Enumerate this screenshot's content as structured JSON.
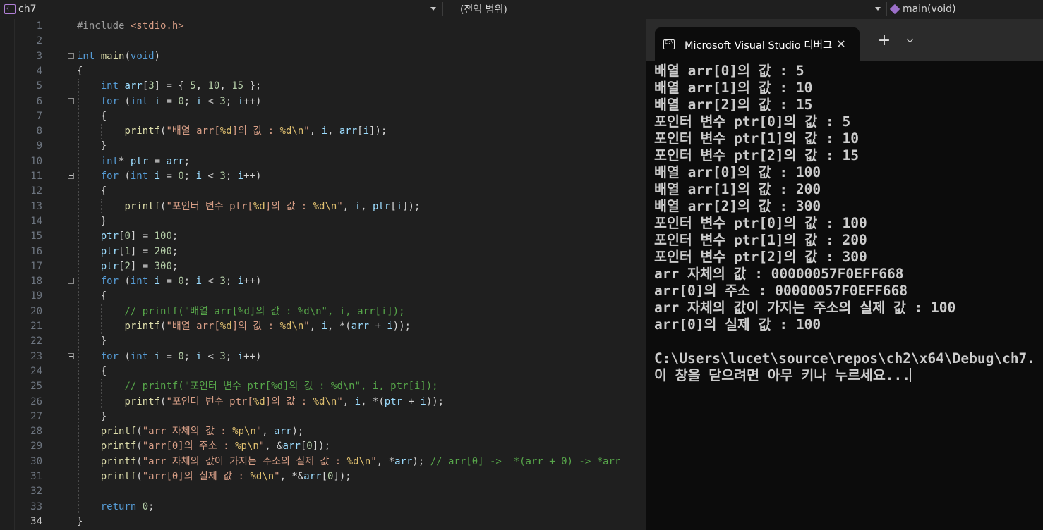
{
  "navbar": {
    "project": "ch7",
    "scope": "(전역 범위)",
    "function": "main(void)"
  },
  "editor": {
    "current_line": 34,
    "lines": [
      {
        "n": "1",
        "tokens": [
          {
            "t": "pp",
            "v": "#include "
          },
          {
            "t": "inc",
            "v": "<stdio.h>"
          }
        ]
      },
      {
        "n": "2",
        "tokens": []
      },
      {
        "n": "3",
        "tokens": [
          {
            "t": "kw",
            "v": "int"
          },
          {
            "t": "pl",
            "v": " "
          },
          {
            "t": "fn",
            "v": "main"
          },
          {
            "t": "pl",
            "v": "("
          },
          {
            "t": "kw",
            "v": "void"
          },
          {
            "t": "pl",
            "v": ")"
          }
        ]
      },
      {
        "n": "4",
        "tokens": [
          {
            "t": "pl",
            "v": "{"
          }
        ]
      },
      {
        "n": "5",
        "tokens": [
          {
            "t": "pl",
            "v": "    "
          },
          {
            "t": "kw",
            "v": "int"
          },
          {
            "t": "pl",
            "v": " "
          },
          {
            "t": "var",
            "v": "arr"
          },
          {
            "t": "pl",
            "v": "["
          },
          {
            "t": "num",
            "v": "3"
          },
          {
            "t": "pl",
            "v": "] = { "
          },
          {
            "t": "num",
            "v": "5"
          },
          {
            "t": "pl",
            "v": ", "
          },
          {
            "t": "num",
            "v": "10"
          },
          {
            "t": "pl",
            "v": ", "
          },
          {
            "t": "num",
            "v": "15"
          },
          {
            "t": "pl",
            "v": " };"
          }
        ]
      },
      {
        "n": "6",
        "tokens": [
          {
            "t": "pl",
            "v": "    "
          },
          {
            "t": "kw",
            "v": "for"
          },
          {
            "t": "pl",
            "v": " ("
          },
          {
            "t": "kw",
            "v": "int"
          },
          {
            "t": "pl",
            "v": " "
          },
          {
            "t": "var",
            "v": "i"
          },
          {
            "t": "pl",
            "v": " = "
          },
          {
            "t": "num",
            "v": "0"
          },
          {
            "t": "pl",
            "v": "; "
          },
          {
            "t": "var",
            "v": "i"
          },
          {
            "t": "pl",
            "v": " < "
          },
          {
            "t": "num",
            "v": "3"
          },
          {
            "t": "pl",
            "v": "; "
          },
          {
            "t": "var",
            "v": "i"
          },
          {
            "t": "pl",
            "v": "++)"
          }
        ]
      },
      {
        "n": "7",
        "tokens": [
          {
            "t": "pl",
            "v": "    {"
          }
        ]
      },
      {
        "n": "8",
        "tokens": [
          {
            "t": "pl",
            "v": "        "
          },
          {
            "t": "fn",
            "v": "printf"
          },
          {
            "t": "pl",
            "v": "("
          },
          {
            "t": "str",
            "v": "\"배열 arr["
          },
          {
            "t": "esc",
            "v": "%d"
          },
          {
            "t": "str",
            "v": "]의 값 : "
          },
          {
            "t": "esc",
            "v": "%d\\n"
          },
          {
            "t": "str",
            "v": "\""
          },
          {
            "t": "pl",
            "v": ", "
          },
          {
            "t": "var",
            "v": "i"
          },
          {
            "t": "pl",
            "v": ", "
          },
          {
            "t": "var",
            "v": "arr"
          },
          {
            "t": "pl",
            "v": "["
          },
          {
            "t": "var",
            "v": "i"
          },
          {
            "t": "pl",
            "v": "]);"
          }
        ]
      },
      {
        "n": "9",
        "tokens": [
          {
            "t": "pl",
            "v": "    }"
          }
        ]
      },
      {
        "n": "10",
        "tokens": [
          {
            "t": "pl",
            "v": "    "
          },
          {
            "t": "kw",
            "v": "int"
          },
          {
            "t": "pl",
            "v": "* "
          },
          {
            "t": "var",
            "v": "ptr"
          },
          {
            "t": "pl",
            "v": " = "
          },
          {
            "t": "var",
            "v": "arr"
          },
          {
            "t": "pl",
            "v": ";"
          }
        ]
      },
      {
        "n": "11",
        "tokens": [
          {
            "t": "pl",
            "v": "    "
          },
          {
            "t": "kw",
            "v": "for"
          },
          {
            "t": "pl",
            "v": " ("
          },
          {
            "t": "kw",
            "v": "int"
          },
          {
            "t": "pl",
            "v": " "
          },
          {
            "t": "var",
            "v": "i"
          },
          {
            "t": "pl",
            "v": " = "
          },
          {
            "t": "num",
            "v": "0"
          },
          {
            "t": "pl",
            "v": "; "
          },
          {
            "t": "var",
            "v": "i"
          },
          {
            "t": "pl",
            "v": " < "
          },
          {
            "t": "num",
            "v": "3"
          },
          {
            "t": "pl",
            "v": "; "
          },
          {
            "t": "var",
            "v": "i"
          },
          {
            "t": "pl",
            "v": "++)"
          }
        ]
      },
      {
        "n": "12",
        "tokens": [
          {
            "t": "pl",
            "v": "    {"
          }
        ]
      },
      {
        "n": "13",
        "tokens": [
          {
            "t": "pl",
            "v": "        "
          },
          {
            "t": "fn",
            "v": "printf"
          },
          {
            "t": "pl",
            "v": "("
          },
          {
            "t": "str",
            "v": "\"포인터 변수 ptr["
          },
          {
            "t": "esc",
            "v": "%d"
          },
          {
            "t": "str",
            "v": "]의 값 : "
          },
          {
            "t": "esc",
            "v": "%d\\n"
          },
          {
            "t": "str",
            "v": "\""
          },
          {
            "t": "pl",
            "v": ", "
          },
          {
            "t": "var",
            "v": "i"
          },
          {
            "t": "pl",
            "v": ", "
          },
          {
            "t": "var",
            "v": "ptr"
          },
          {
            "t": "pl",
            "v": "["
          },
          {
            "t": "var",
            "v": "i"
          },
          {
            "t": "pl",
            "v": "]);"
          }
        ]
      },
      {
        "n": "14",
        "tokens": [
          {
            "t": "pl",
            "v": "    }"
          }
        ]
      },
      {
        "n": "15",
        "tokens": [
          {
            "t": "pl",
            "v": "    "
          },
          {
            "t": "var",
            "v": "ptr"
          },
          {
            "t": "pl",
            "v": "["
          },
          {
            "t": "num",
            "v": "0"
          },
          {
            "t": "pl",
            "v": "] = "
          },
          {
            "t": "num",
            "v": "100"
          },
          {
            "t": "pl",
            "v": ";"
          }
        ]
      },
      {
        "n": "16",
        "tokens": [
          {
            "t": "pl",
            "v": "    "
          },
          {
            "t": "var",
            "v": "ptr"
          },
          {
            "t": "pl",
            "v": "["
          },
          {
            "t": "num",
            "v": "1"
          },
          {
            "t": "pl",
            "v": "] = "
          },
          {
            "t": "num",
            "v": "200"
          },
          {
            "t": "pl",
            "v": ";"
          }
        ]
      },
      {
        "n": "17",
        "tokens": [
          {
            "t": "pl",
            "v": "    "
          },
          {
            "t": "var",
            "v": "ptr"
          },
          {
            "t": "pl",
            "v": "["
          },
          {
            "t": "num",
            "v": "2"
          },
          {
            "t": "pl",
            "v": "] = "
          },
          {
            "t": "num",
            "v": "300"
          },
          {
            "t": "pl",
            "v": ";"
          }
        ]
      },
      {
        "n": "18",
        "tokens": [
          {
            "t": "pl",
            "v": "    "
          },
          {
            "t": "kw",
            "v": "for"
          },
          {
            "t": "pl",
            "v": " ("
          },
          {
            "t": "kw",
            "v": "int"
          },
          {
            "t": "pl",
            "v": " "
          },
          {
            "t": "var",
            "v": "i"
          },
          {
            "t": "pl",
            "v": " = "
          },
          {
            "t": "num",
            "v": "0"
          },
          {
            "t": "pl",
            "v": "; "
          },
          {
            "t": "var",
            "v": "i"
          },
          {
            "t": "pl",
            "v": " < "
          },
          {
            "t": "num",
            "v": "3"
          },
          {
            "t": "pl",
            "v": "; "
          },
          {
            "t": "var",
            "v": "i"
          },
          {
            "t": "pl",
            "v": "++)"
          }
        ]
      },
      {
        "n": "19",
        "tokens": [
          {
            "t": "pl",
            "v": "    {"
          }
        ]
      },
      {
        "n": "20",
        "tokens": [
          {
            "t": "pl",
            "v": "        "
          },
          {
            "t": "cm",
            "v": "// printf(\"배열 arr[%d]의 값 : %d\\n\", i, arr[i]);"
          }
        ]
      },
      {
        "n": "21",
        "tokens": [
          {
            "t": "pl",
            "v": "        "
          },
          {
            "t": "fn",
            "v": "printf"
          },
          {
            "t": "pl",
            "v": "("
          },
          {
            "t": "str",
            "v": "\"배열 arr["
          },
          {
            "t": "esc",
            "v": "%d"
          },
          {
            "t": "str",
            "v": "]의 값 : "
          },
          {
            "t": "esc",
            "v": "%d\\n"
          },
          {
            "t": "str",
            "v": "\""
          },
          {
            "t": "pl",
            "v": ", "
          },
          {
            "t": "var",
            "v": "i"
          },
          {
            "t": "pl",
            "v": ", *("
          },
          {
            "t": "var",
            "v": "arr"
          },
          {
            "t": "pl",
            "v": " + "
          },
          {
            "t": "var",
            "v": "i"
          },
          {
            "t": "pl",
            "v": "));"
          }
        ]
      },
      {
        "n": "22",
        "tokens": [
          {
            "t": "pl",
            "v": "    }"
          }
        ]
      },
      {
        "n": "23",
        "tokens": [
          {
            "t": "pl",
            "v": "    "
          },
          {
            "t": "kw",
            "v": "for"
          },
          {
            "t": "pl",
            "v": " ("
          },
          {
            "t": "kw",
            "v": "int"
          },
          {
            "t": "pl",
            "v": " "
          },
          {
            "t": "var",
            "v": "i"
          },
          {
            "t": "pl",
            "v": " = "
          },
          {
            "t": "num",
            "v": "0"
          },
          {
            "t": "pl",
            "v": "; "
          },
          {
            "t": "var",
            "v": "i"
          },
          {
            "t": "pl",
            "v": " < "
          },
          {
            "t": "num",
            "v": "3"
          },
          {
            "t": "pl",
            "v": "; "
          },
          {
            "t": "var",
            "v": "i"
          },
          {
            "t": "pl",
            "v": "++)"
          }
        ]
      },
      {
        "n": "24",
        "tokens": [
          {
            "t": "pl",
            "v": "    {"
          }
        ]
      },
      {
        "n": "25",
        "tokens": [
          {
            "t": "pl",
            "v": "        "
          },
          {
            "t": "cm",
            "v": "// printf(\"포인터 변수 ptr[%d]의 값 : %d\\n\", i, ptr[i]);"
          }
        ]
      },
      {
        "n": "26",
        "tokens": [
          {
            "t": "pl",
            "v": "        "
          },
          {
            "t": "fn",
            "v": "printf"
          },
          {
            "t": "pl",
            "v": "("
          },
          {
            "t": "str",
            "v": "\"포인터 변수 ptr["
          },
          {
            "t": "esc",
            "v": "%d"
          },
          {
            "t": "str",
            "v": "]의 값 : "
          },
          {
            "t": "esc",
            "v": "%d\\n"
          },
          {
            "t": "str",
            "v": "\""
          },
          {
            "t": "pl",
            "v": ", "
          },
          {
            "t": "var",
            "v": "i"
          },
          {
            "t": "pl",
            "v": ", *("
          },
          {
            "t": "var",
            "v": "ptr"
          },
          {
            "t": "pl",
            "v": " + "
          },
          {
            "t": "var",
            "v": "i"
          },
          {
            "t": "pl",
            "v": "));"
          }
        ]
      },
      {
        "n": "27",
        "tokens": [
          {
            "t": "pl",
            "v": "    }"
          }
        ]
      },
      {
        "n": "28",
        "tokens": [
          {
            "t": "pl",
            "v": "    "
          },
          {
            "t": "fn",
            "v": "printf"
          },
          {
            "t": "pl",
            "v": "("
          },
          {
            "t": "str",
            "v": "\"arr 자체의 값 : "
          },
          {
            "t": "esc",
            "v": "%p\\n"
          },
          {
            "t": "str",
            "v": "\""
          },
          {
            "t": "pl",
            "v": ", "
          },
          {
            "t": "var",
            "v": "arr"
          },
          {
            "t": "pl",
            "v": ");"
          }
        ]
      },
      {
        "n": "29",
        "tokens": [
          {
            "t": "pl",
            "v": "    "
          },
          {
            "t": "fn",
            "v": "printf"
          },
          {
            "t": "pl",
            "v": "("
          },
          {
            "t": "str",
            "v": "\"arr[0]의 주소 : "
          },
          {
            "t": "esc",
            "v": "%p\\n"
          },
          {
            "t": "str",
            "v": "\""
          },
          {
            "t": "pl",
            "v": ", &"
          },
          {
            "t": "var",
            "v": "arr"
          },
          {
            "t": "pl",
            "v": "["
          },
          {
            "t": "num",
            "v": "0"
          },
          {
            "t": "pl",
            "v": "]);"
          }
        ]
      },
      {
        "n": "30",
        "tokens": [
          {
            "t": "pl",
            "v": "    "
          },
          {
            "t": "fn",
            "v": "printf"
          },
          {
            "t": "pl",
            "v": "("
          },
          {
            "t": "str",
            "v": "\"arr 자체의 값이 가지는 주소의 실제 값 : "
          },
          {
            "t": "esc",
            "v": "%d\\n"
          },
          {
            "t": "str",
            "v": "\""
          },
          {
            "t": "pl",
            "v": ", *"
          },
          {
            "t": "var",
            "v": "arr"
          },
          {
            "t": "pl",
            "v": "); "
          },
          {
            "t": "cm",
            "v": "// arr[0] ->  *(arr + 0) -> *arr"
          }
        ]
      },
      {
        "n": "31",
        "tokens": [
          {
            "t": "pl",
            "v": "    "
          },
          {
            "t": "fn",
            "v": "printf"
          },
          {
            "t": "pl",
            "v": "("
          },
          {
            "t": "str",
            "v": "\"arr[0]의 실제 값 : "
          },
          {
            "t": "esc",
            "v": "%d\\n"
          },
          {
            "t": "str",
            "v": "\""
          },
          {
            "t": "pl",
            "v": ", *&"
          },
          {
            "t": "var",
            "v": "arr"
          },
          {
            "t": "pl",
            "v": "["
          },
          {
            "t": "num",
            "v": "0"
          },
          {
            "t": "pl",
            "v": "]);"
          }
        ]
      },
      {
        "n": "32",
        "tokens": []
      },
      {
        "n": "33",
        "tokens": [
          {
            "t": "pl",
            "v": "    "
          },
          {
            "t": "kw",
            "v": "return"
          },
          {
            "t": "pl",
            "v": " "
          },
          {
            "t": "num",
            "v": "0"
          },
          {
            "t": "pl",
            "v": ";"
          }
        ]
      },
      {
        "n": "34",
        "tokens": [
          {
            "t": "pl",
            "v": "}"
          }
        ]
      }
    ]
  },
  "console": {
    "tab_title": "Microsoft Visual Studio 디버그",
    "close_glyph": "✕",
    "new_tab_glyph": "+",
    "output": [
      "배열 arr[0]의 값 : 5",
      "배열 arr[1]의 값 : 10",
      "배열 arr[2]의 값 : 15",
      "포인터 변수 ptr[0]의 값 : 5",
      "포인터 변수 ptr[1]의 값 : 10",
      "포인터 변수 ptr[2]의 값 : 15",
      "배열 arr[0]의 값 : 100",
      "배열 arr[1]의 값 : 200",
      "배열 arr[2]의 값 : 300",
      "포인터 변수 ptr[0]의 값 : 100",
      "포인터 변수 ptr[1]의 값 : 200",
      "포인터 변수 ptr[2]의 값 : 300",
      "arr 자체의 값 : 00000057F0EFF668",
      "arr[0]의 주소 : 00000057F0EFF668",
      "arr 자체의 값이 가지는 주소의 실제 값 : 100",
      "arr[0]의 실제 값 : 100",
      "",
      "C:\\Users\\lucet\\source\\repos\\ch2\\x64\\Debug\\ch7.",
      "이 창을 닫으려면 아무 키나 누르세요..."
    ]
  }
}
